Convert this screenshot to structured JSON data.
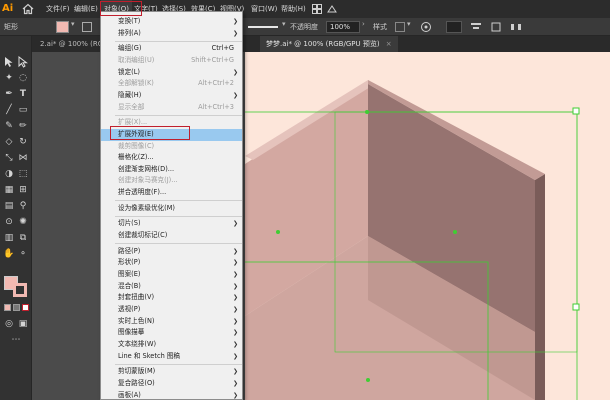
{
  "app": {
    "logo": "Ai"
  },
  "menubar": {
    "items": [
      {
        "label": "文件(F)"
      },
      {
        "label": "编辑(E)"
      },
      {
        "label": "对象(O)"
      },
      {
        "label": "文字(T)"
      },
      {
        "label": "选择(S)"
      },
      {
        "label": "效果(C)"
      },
      {
        "label": "视图(V)"
      },
      {
        "label": "窗口(W)"
      },
      {
        "label": "帮助(H)"
      }
    ]
  },
  "controlbar": {
    "shape_label": "矩形",
    "opacity_label": "不透明度",
    "opacity_value": "100%",
    "style_label": "样式"
  },
  "tabs": [
    {
      "label": "2.ai* @ 100% (RGB"
    },
    {
      "label": "梦梦.ai* @ 100% (RGB/GPU 预览)",
      "close": "×"
    }
  ],
  "object_menu": {
    "items": [
      {
        "label": "变换(T)",
        "submenu": true
      },
      {
        "label": "排列(A)",
        "submenu": true
      },
      {
        "sep": true
      },
      {
        "label": "编组(G)",
        "shortcut": "Ctrl+G"
      },
      {
        "label": "取消编组(U)",
        "shortcut": "Shift+Ctrl+G",
        "disabled": true
      },
      {
        "label": "锁定(L)",
        "submenu": true
      },
      {
        "label": "全部解锁(K)",
        "shortcut": "Alt+Ctrl+2",
        "disabled": true
      },
      {
        "label": "隐藏(H)",
        "submenu": true
      },
      {
        "label": "显示全部",
        "shortcut": "Alt+Ctrl+3",
        "disabled": true
      },
      {
        "sep": true
      },
      {
        "label": "扩展(X)...",
        "disabled": true
      },
      {
        "label": "扩展外观(E)",
        "highlight": true
      },
      {
        "label": "裁剪图像(C)",
        "disabled": true
      },
      {
        "label": "栅格化(Z)..."
      },
      {
        "label": "创建渐变网格(D)..."
      },
      {
        "label": "创建对象马赛克(J)...",
        "disabled": true
      },
      {
        "label": "拼合透明度(F)..."
      },
      {
        "sep": true
      },
      {
        "label": "设为像素级优化(M)"
      },
      {
        "sep": true
      },
      {
        "label": "切片(S)",
        "submenu": true
      },
      {
        "label": "创建裁切标记(C)"
      },
      {
        "sep": true
      },
      {
        "label": "路径(P)",
        "submenu": true
      },
      {
        "label": "形状(P)",
        "submenu": true
      },
      {
        "label": "图案(E)",
        "submenu": true
      },
      {
        "label": "混合(B)",
        "submenu": true
      },
      {
        "label": "封套扭曲(V)",
        "submenu": true
      },
      {
        "label": "透视(P)",
        "submenu": true
      },
      {
        "label": "实时上色(N)",
        "submenu": true
      },
      {
        "label": "图像描摹",
        "submenu": true
      },
      {
        "label": "文本绕排(W)",
        "submenu": true
      },
      {
        "label": "Line 和 Sketch 图稿",
        "submenu": true
      },
      {
        "sep": true
      },
      {
        "label": "剪切蒙版(M)",
        "submenu": true
      },
      {
        "label": "复合路径(O)",
        "submenu": true
      },
      {
        "label": "画板(A)",
        "submenu": true
      }
    ]
  },
  "colors": {
    "accent": "#ff9a00",
    "fill": "#f1b9b2",
    "artboard": "#fde6da",
    "menu_highlight": "#99c9ef",
    "annotation": "#c01f2d",
    "selection": "#3fce33"
  }
}
